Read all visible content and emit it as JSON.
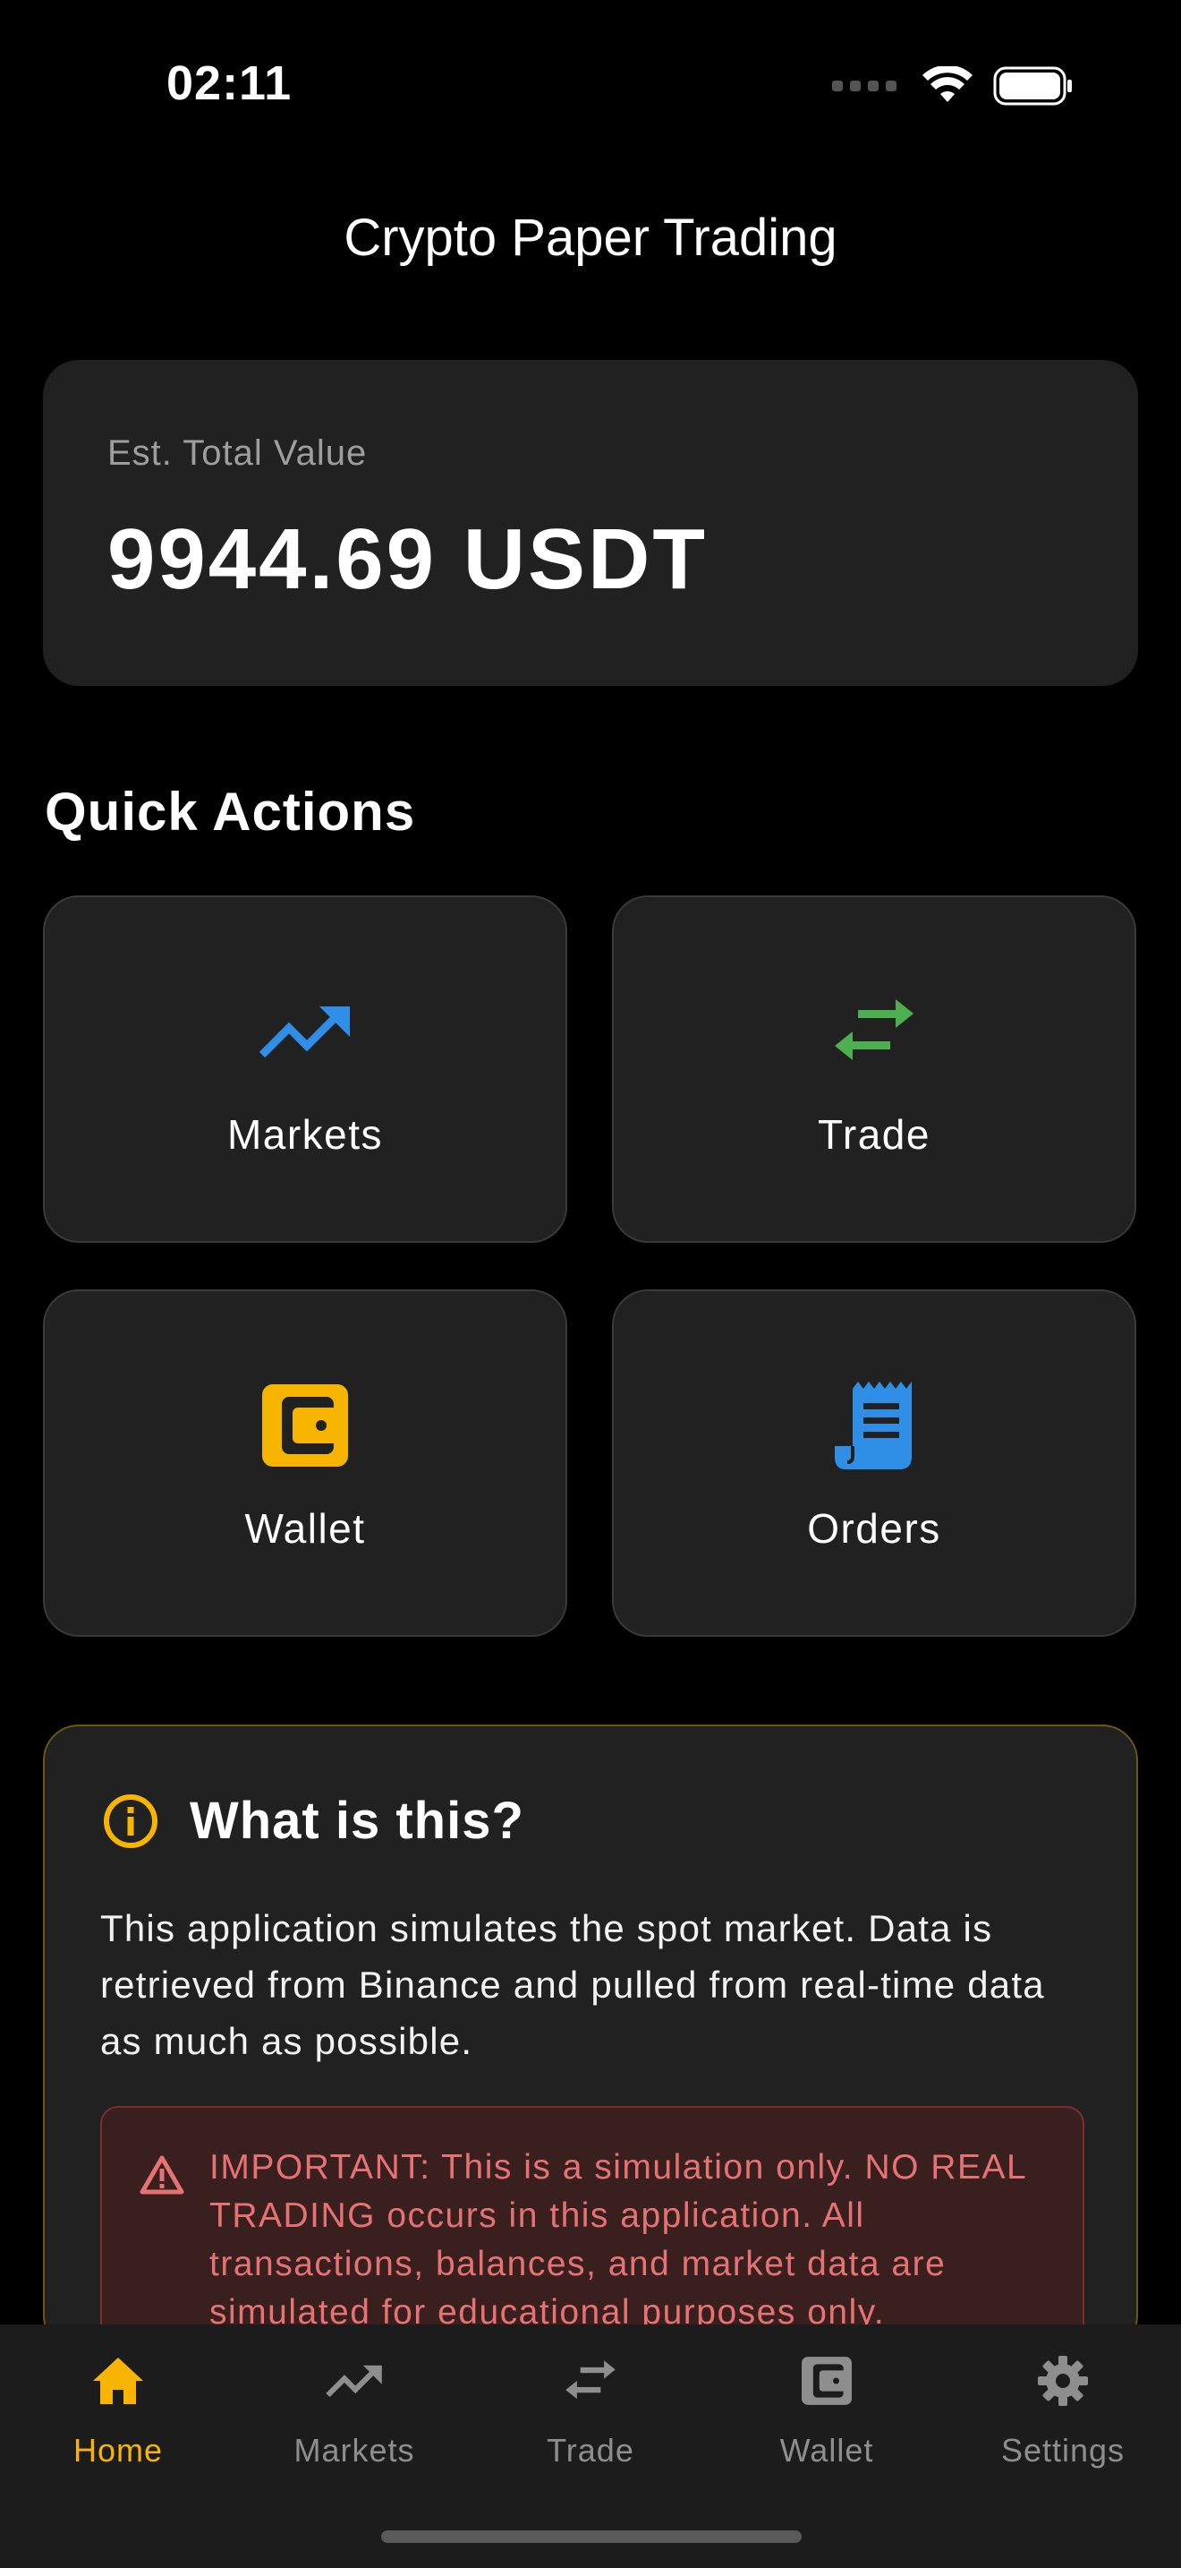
{
  "status_bar": {
    "time": "02:11"
  },
  "nav": {
    "title": "Crypto Paper Trading"
  },
  "portfolio": {
    "label": "Est. Total Value",
    "value": "9944.69 USDT"
  },
  "quick_actions": {
    "title": "Quick Actions",
    "items": [
      {
        "label": "Markets",
        "icon": "trending-up-icon",
        "color": "#2f8fe6"
      },
      {
        "label": "Trade",
        "icon": "swap-arrows-icon",
        "color": "#4caf50"
      },
      {
        "label": "Wallet",
        "icon": "wallet-icon",
        "color": "#f7b500"
      },
      {
        "label": "Orders",
        "icon": "receipt-icon",
        "color": "#2f8fe6"
      }
    ]
  },
  "info": {
    "title": "What is this?",
    "body": "This application simulates the spot market. Data is retrieved from Binance and pulled from real-time data as much as possible.",
    "warning": "IMPORTANT: This is a simulation only. NO REAL TRADING occurs in this application. All transactions, balances, and market data are simulated for educational purposes only.",
    "accent": "#f7b500",
    "warning_color": "#e57373"
  },
  "tab_bar": {
    "active": "Home",
    "active_color": "#f7b500",
    "items": [
      {
        "label": "Home",
        "icon": "home-icon"
      },
      {
        "label": "Markets",
        "icon": "trending-up-icon"
      },
      {
        "label": "Trade",
        "icon": "swap-arrows-icon"
      },
      {
        "label": "Wallet",
        "icon": "wallet-icon"
      },
      {
        "label": "Settings",
        "icon": "gear-icon"
      }
    ]
  }
}
